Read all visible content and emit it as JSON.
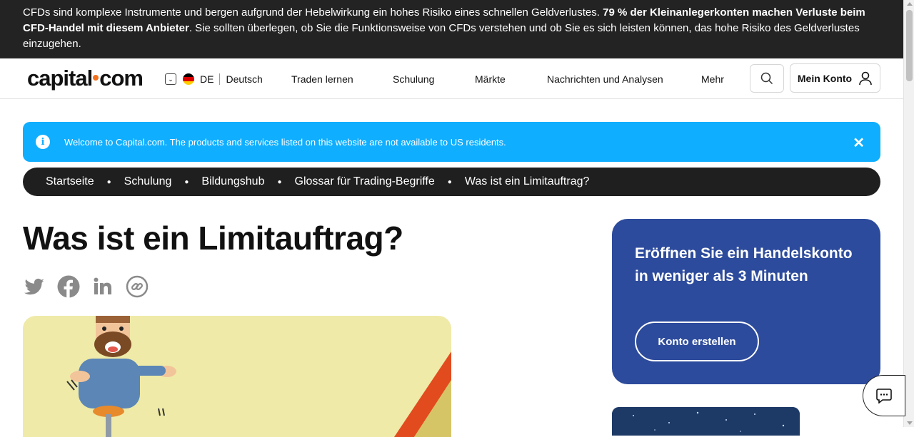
{
  "risk_warning": {
    "part1": "CFDs sind komplexe Instrumente und bergen aufgrund der Hebelwirkung ein hohes Risiko eines schnellen Geldverlustes.",
    "bold": "79 % der Kleinanlegerkonten machen Verluste beim CFD-Handel mit diesem Anbieter",
    "part2": ". Sie sollten überlegen, ob Sie die Funktionsweise von CFDs verstehen und ob Sie es sich leisten können, das hohe Risiko des Geldverlustes einzugehen."
  },
  "header": {
    "logo_left": "capital",
    "logo_right": "com",
    "lang_code": "DE",
    "lang_name": "Deutsch",
    "nav": [
      "Traden lernen",
      "Schulung",
      "Märkte",
      "Nachrichten und Analysen",
      "Mehr"
    ],
    "account_label": "Mein Konto"
  },
  "info_banner": {
    "text": "Welcome to Capital.com. The products and services listed on this website are not available to US residents.",
    "icon": "info-icon"
  },
  "breadcrumb": [
    "Startseite",
    "Schulung",
    "Bildungshub",
    "Glossar für Trading-Begriffe",
    "Was ist ein Limitauftrag?"
  ],
  "page": {
    "title": "Was ist ein Limitauftrag?",
    "share_icons": [
      "twitter-icon",
      "facebook-icon",
      "linkedin-icon",
      "copy-link-icon"
    ]
  },
  "cta": {
    "title": "Eröffnen Sie ein Handelskonto in weniger als 3 Minuten",
    "button": "Konto erstellen"
  },
  "colors": {
    "risk_bg": "#232323",
    "banner_bg": "#0faeff",
    "breadcrumb_bg": "#1f1f1f",
    "cta_bg": "#2d4b9c",
    "hero_bg": "#efeaa8",
    "logo_dot": "#f4701b"
  }
}
